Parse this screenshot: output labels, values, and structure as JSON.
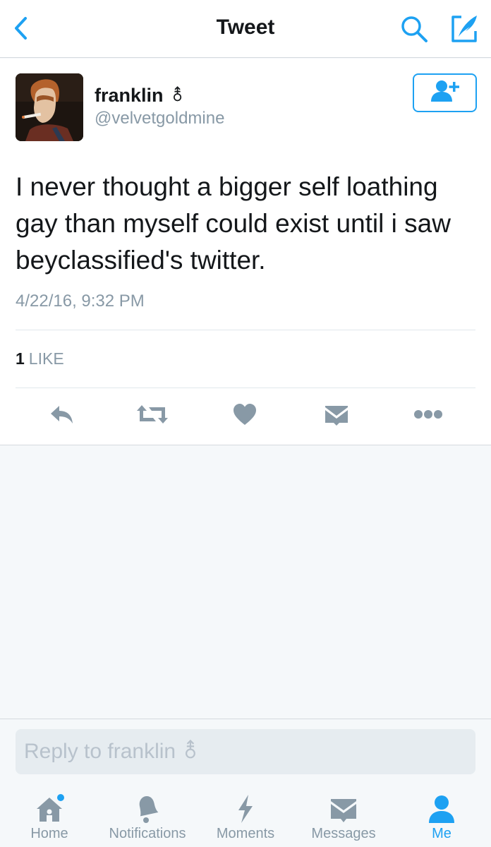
{
  "nav": {
    "title": "Tweet",
    "back_icon": "chevron-left-icon",
    "search_icon": "search-icon",
    "compose_icon": "compose-quill-icon"
  },
  "tweet": {
    "display_name": "franklin",
    "name_symbol": "⚨",
    "handle": "@velvetgoldmine",
    "text": "I never thought a bigger self loathing gay than myself could exist until i saw beyclassified's twitter.",
    "timestamp": "4/22/16, 9:32 PM",
    "likes_count": "1",
    "likes_label": "LIKE",
    "follow_icon": "add-user-icon"
  },
  "actions": [
    {
      "name": "reply",
      "icon": "reply-icon"
    },
    {
      "name": "retweet",
      "icon": "retweet-icon"
    },
    {
      "name": "like",
      "icon": "heart-icon"
    },
    {
      "name": "direct-message",
      "icon": "envelope-icon"
    },
    {
      "name": "more",
      "icon": "more-dots-icon"
    }
  ],
  "reply": {
    "placeholder": "Reply to franklin ⚨"
  },
  "tabs": [
    {
      "label": "Home",
      "icon": "home-icon",
      "active": false,
      "has_dot": true
    },
    {
      "label": "Notifications",
      "icon": "bell-icon",
      "active": false
    },
    {
      "label": "Moments",
      "icon": "lightning-icon",
      "active": false
    },
    {
      "label": "Messages",
      "icon": "envelope-icon",
      "active": false
    },
    {
      "label": "Me",
      "icon": "person-icon",
      "active": true
    }
  ],
  "colors": {
    "accent": "#1da1f2",
    "icon_gray": "#8899a6",
    "text_dark": "#14171a",
    "background": "#f5f8fa"
  }
}
